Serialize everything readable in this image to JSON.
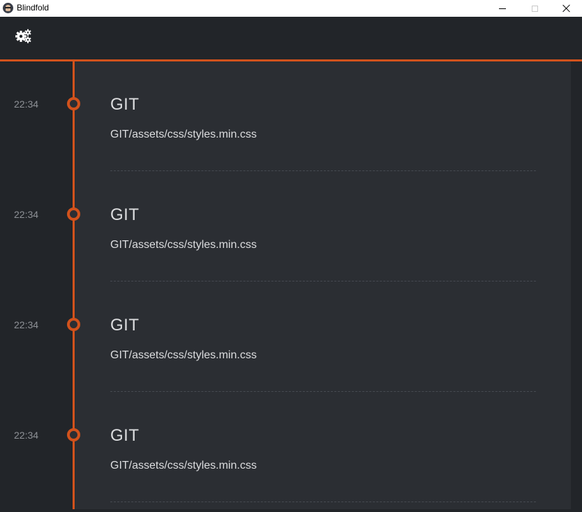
{
  "window": {
    "title": "Blindfold",
    "icons": {
      "app": "blindfold-app-icon",
      "minimize": "minimize-icon",
      "maximize": "maximize-icon",
      "close": "close-icon"
    }
  },
  "toolbar": {
    "settings_icon": "cogs-icon"
  },
  "colors": {
    "accent": "#d2521c",
    "background": "#2b2e33",
    "sidebar": "#222529",
    "text": "#dcdddf",
    "muted_text": "#8e9196"
  },
  "timeline": {
    "entries": [
      {
        "time": "22:34",
        "title": "GIT",
        "path": "GIT/assets/css/styles.min.css"
      },
      {
        "time": "22:34",
        "title": "GIT",
        "path": "GIT/assets/css/styles.min.css"
      },
      {
        "time": "22:34",
        "title": "GIT",
        "path": "GIT/assets/css/styles.min.css"
      },
      {
        "time": "22:34",
        "title": "GIT",
        "path": "GIT/assets/css/styles.min.css"
      }
    ]
  }
}
